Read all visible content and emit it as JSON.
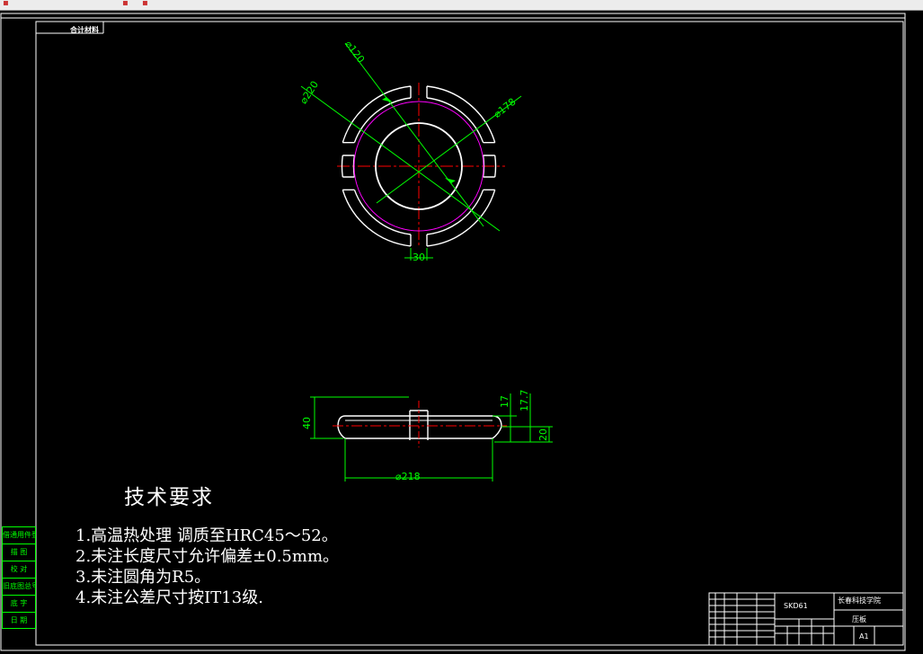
{
  "corner_label": "合计材料",
  "dimensions": {
    "inner_dia": "⌀120",
    "outer_dia": "⌀220",
    "pitch_dia": "⌀178",
    "slot_width": "30",
    "height_overall": "40",
    "dim_17": "17",
    "dim_17_7": "17.7",
    "dim_20": "20",
    "base_dia": "⌀218"
  },
  "requirements": {
    "title": "技术要求",
    "items": [
      "1.高温热处理 调质至HRC45～52。",
      "2.未注长度尺寸允许偏差±0.5mm。",
      "3.未注圆角为R5。",
      "4.未注公差尺寸按IT13级."
    ]
  },
  "side_panel": [
    "借通用件登记",
    "描 图",
    "校 对",
    "旧底图总号",
    "底 字",
    "日 期"
  ],
  "title_block": {
    "material": "SKD61",
    "school": "长春科技学院",
    "part_name": "压板",
    "sheet_size": "A1"
  },
  "colors": {
    "background": "#000000",
    "outline": "#ffffff",
    "dimension": "#00ff00",
    "centerline": "#ff0000",
    "pitch_circle": "#ff00ff"
  }
}
